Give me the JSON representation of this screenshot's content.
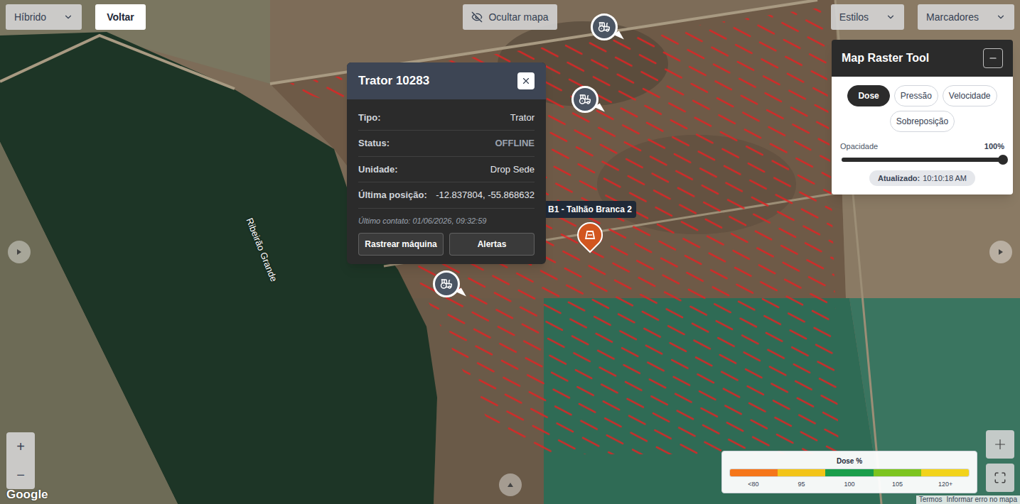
{
  "toolbar": {
    "map_type": "Híbrido",
    "back": "Voltar",
    "hide_map": "Ocultar mapa",
    "styles": "Estilos",
    "markers": "Marcadores"
  },
  "machine_popup": {
    "title": "Trator 10283",
    "fields": [
      {
        "label": "Tipo:",
        "value": "Trator",
        "muted": false
      },
      {
        "label": "Status:",
        "value": "OFFLINE",
        "muted": true
      },
      {
        "label": "Unidade:",
        "value": "Drop Sede",
        "muted": false
      },
      {
        "label": "Última posição:",
        "value": "-12.837804, -55.868632",
        "muted": false
      }
    ],
    "last_contact": "Último contato: 01/06/2026, 09:32:59",
    "buttons": [
      "Rastrear máquina",
      "Alertas"
    ]
  },
  "map": {
    "labels": [
      "Ribeirão Grande"
    ],
    "markers": [
      {
        "kind": "machine",
        "label": ""
      },
      {
        "kind": "machine",
        "label": ""
      },
      {
        "kind": "field",
        "label": "B1 - Talhão Branca 2"
      },
      {
        "kind": "machine",
        "label": ""
      }
    ]
  },
  "raster_tool": {
    "title": "Map Raster Tool",
    "layers": [
      {
        "label": "Dose",
        "selected": true
      },
      {
        "label": "Pressão",
        "selected": false
      },
      {
        "label": "Velocidade",
        "selected": false
      },
      {
        "label": "Sobreposição",
        "selected": false
      }
    ],
    "opacity": {
      "label": "Opacidade",
      "reading": "100%",
      "level": 1
    },
    "updated": {
      "label": "Atualizado:",
      "time": "10:10:18 AM"
    }
  },
  "legend": {
    "title": "Dose %",
    "segments": [
      {
        "label": "<80",
        "color": "#f5761a"
      },
      {
        "label": "95",
        "color": "#f2c418"
      },
      {
        "label": "100",
        "color": "#1a9e4b"
      },
      {
        "label": "105",
        "color": "#7cc41f"
      },
      {
        "label": "120+",
        "color": "#f2d31b"
      }
    ]
  },
  "zoom": [
    "+",
    "−"
  ],
  "attribution": {
    "logo": "Google",
    "links": [
      "Termos",
      "Informar erro no mapa"
    ]
  }
}
